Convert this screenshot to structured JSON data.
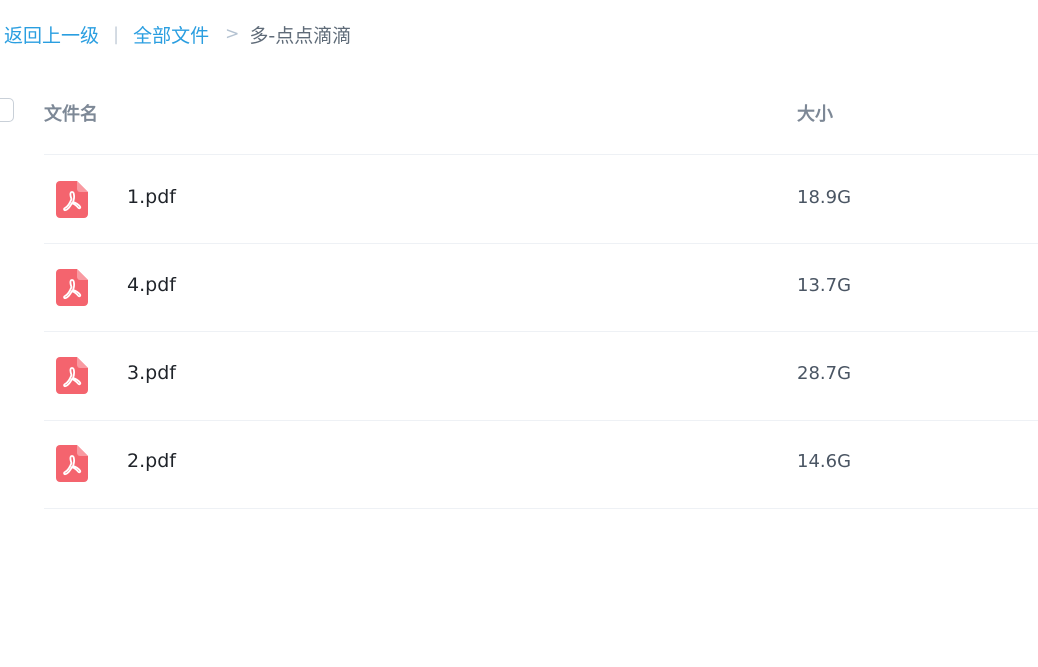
{
  "breadcrumb": {
    "back_label": "返回上一级",
    "divider": "|",
    "all_files_label": "全部文件",
    "separator": ">",
    "current_folder": "多-点点滴滴"
  },
  "table": {
    "columns": {
      "name": "文件名",
      "size": "大小"
    },
    "rows": [
      {
        "name": "1.pdf",
        "size": "18.9G",
        "icon": "pdf-icon"
      },
      {
        "name": "4.pdf",
        "size": "13.7G",
        "icon": "pdf-icon"
      },
      {
        "name": "3.pdf",
        "size": "28.7G",
        "icon": "pdf-icon"
      },
      {
        "name": "2.pdf",
        "size": "14.6G",
        "icon": "pdf-icon"
      }
    ]
  },
  "colors": {
    "link": "#2a9ee0",
    "pdf_icon": "#f4646e",
    "header_text": "#7d8896"
  }
}
